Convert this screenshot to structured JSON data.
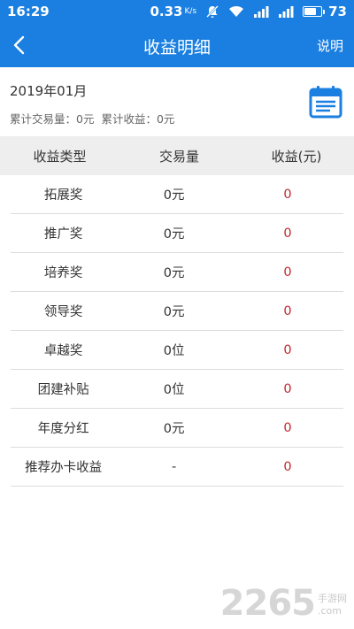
{
  "status_bar": {
    "time": "16:29",
    "speed": "0.33",
    "speed_unit": "K/s",
    "battery": "73",
    "battery_level": 0.73
  },
  "nav": {
    "title": "收益明细",
    "help_label": "说明",
    "back_icon": "chevron-left-icon"
  },
  "summary": {
    "month": "2019年01月",
    "total_volume": "累计交易量：0元",
    "total_income": "累计收益：0元",
    "calendar_icon": "calendar-icon"
  },
  "table": {
    "headers": [
      "收益类型",
      "交易量",
      "收益(元)"
    ],
    "rows": [
      {
        "type": "拓展奖",
        "volume": "0元",
        "income": "0"
      },
      {
        "type": "推广奖",
        "volume": "0元",
        "income": "0"
      },
      {
        "type": "培养奖",
        "volume": "0元",
        "income": "0"
      },
      {
        "type": "领导奖",
        "volume": "0元",
        "income": "0"
      },
      {
        "type": "卓越奖",
        "volume": "0位",
        "income": "0"
      },
      {
        "type": "团建补贴",
        "volume": "0位",
        "income": "0"
      },
      {
        "type": "年度分红",
        "volume": "0元",
        "income": "0"
      },
      {
        "type": "推荐办卡收益",
        "volume": "-",
        "income": "0"
      }
    ]
  },
  "watermark": {
    "number": "2265",
    "suffix": "手游网",
    "domain": ".com"
  },
  "colors": {
    "primary": "#1a7fe0",
    "income": "#c0282c",
    "header_bg": "#eeeeee"
  }
}
